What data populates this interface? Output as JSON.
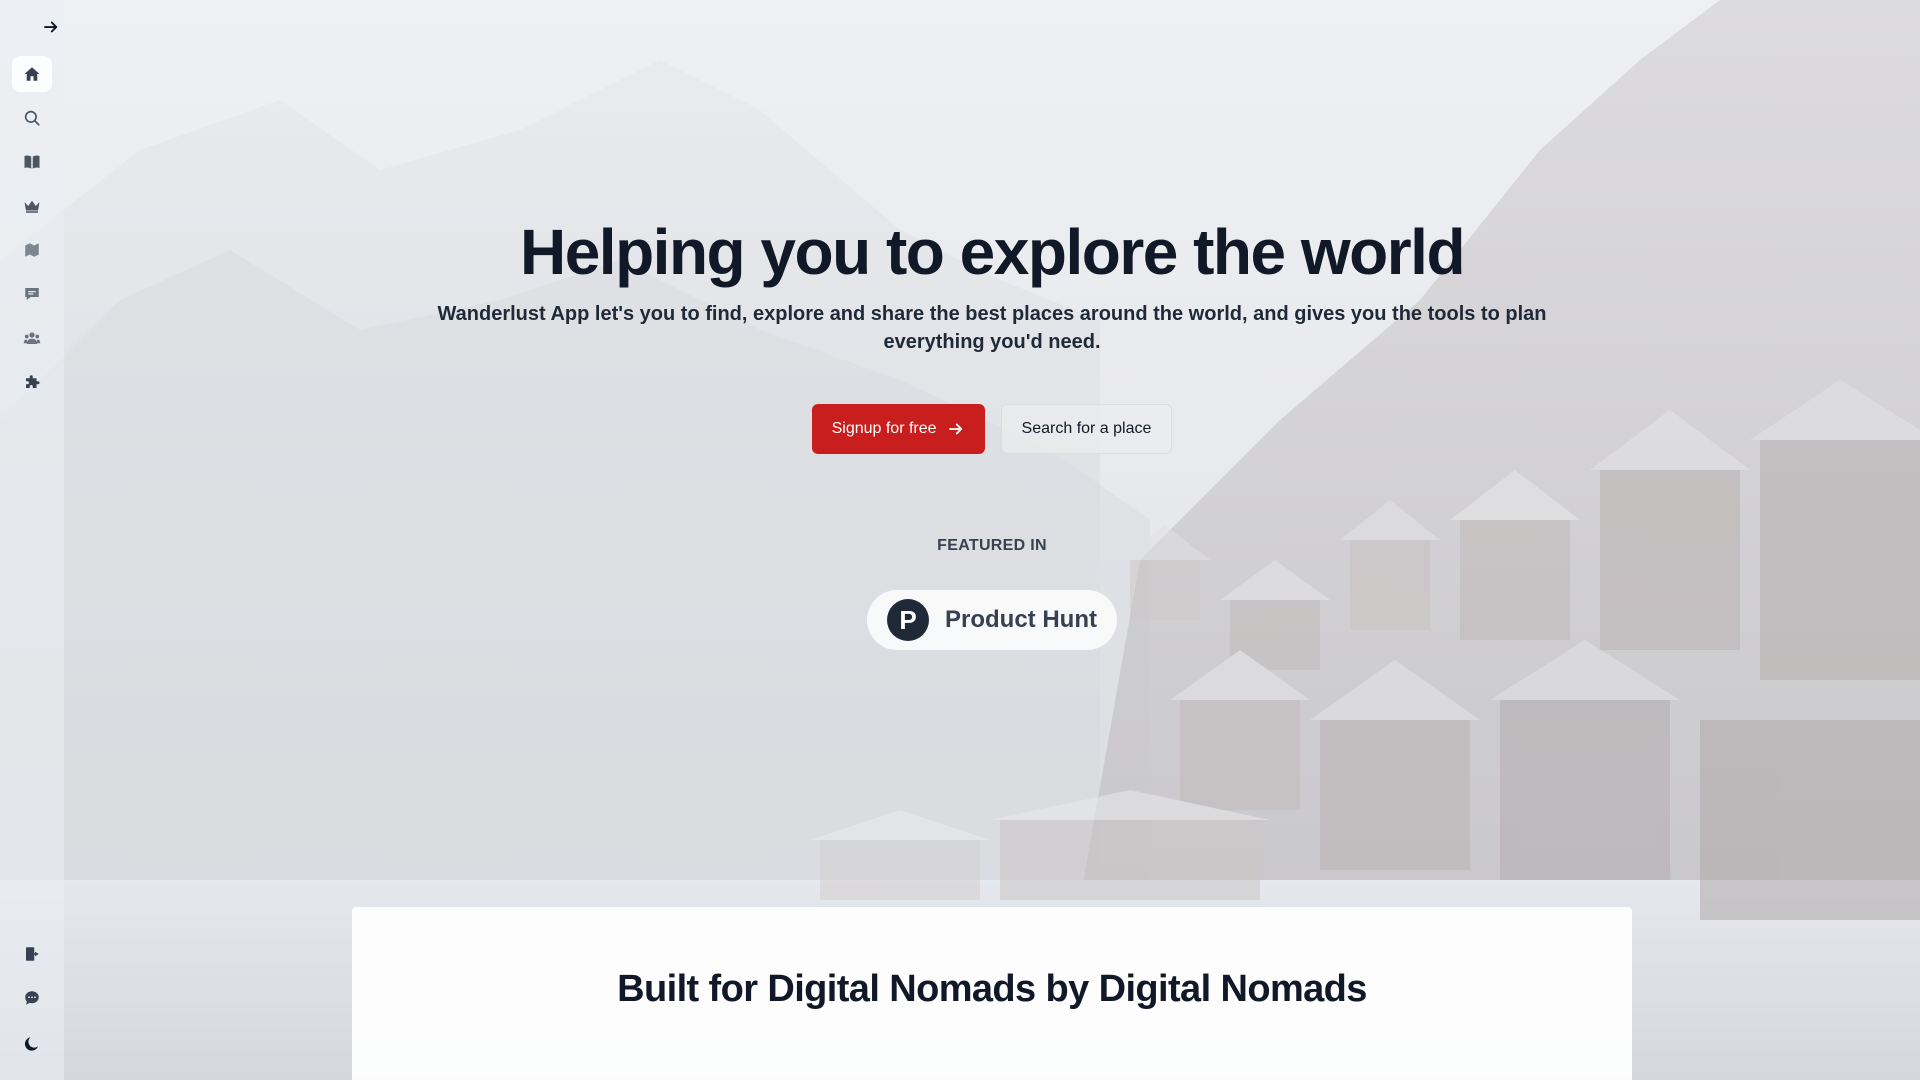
{
  "sidebar": {
    "toggle_icon": "arrow-right-icon",
    "items": [
      {
        "icon": "home-icon",
        "active": true
      },
      {
        "icon": "search-icon"
      },
      {
        "icon": "book-open-icon"
      },
      {
        "icon": "crown-icon"
      },
      {
        "icon": "map-icon"
      },
      {
        "icon": "chat-bubble-icon"
      },
      {
        "icon": "users-icon"
      },
      {
        "icon": "puzzle-icon"
      }
    ],
    "bottom_items": [
      {
        "icon": "logout-icon"
      },
      {
        "icon": "message-circle-icon"
      },
      {
        "icon": "moon-icon"
      }
    ]
  },
  "hero": {
    "title": "Helping you to explore the world",
    "subtitle": "Wanderlust App let's you to find, explore and share the best places around the world, and gives you the tools to plan everything you'd need.",
    "primary_button": "Signup for free",
    "secondary_button": "Search for a place",
    "featured_label": "FEATURED IN",
    "featured": {
      "logo_letter": "P",
      "name": "Product Hunt"
    }
  },
  "section": {
    "title": "Built for Digital Nomads by Digital Nomads"
  },
  "colors": {
    "accent": "#c81e1e",
    "text_dark": "#111827"
  }
}
